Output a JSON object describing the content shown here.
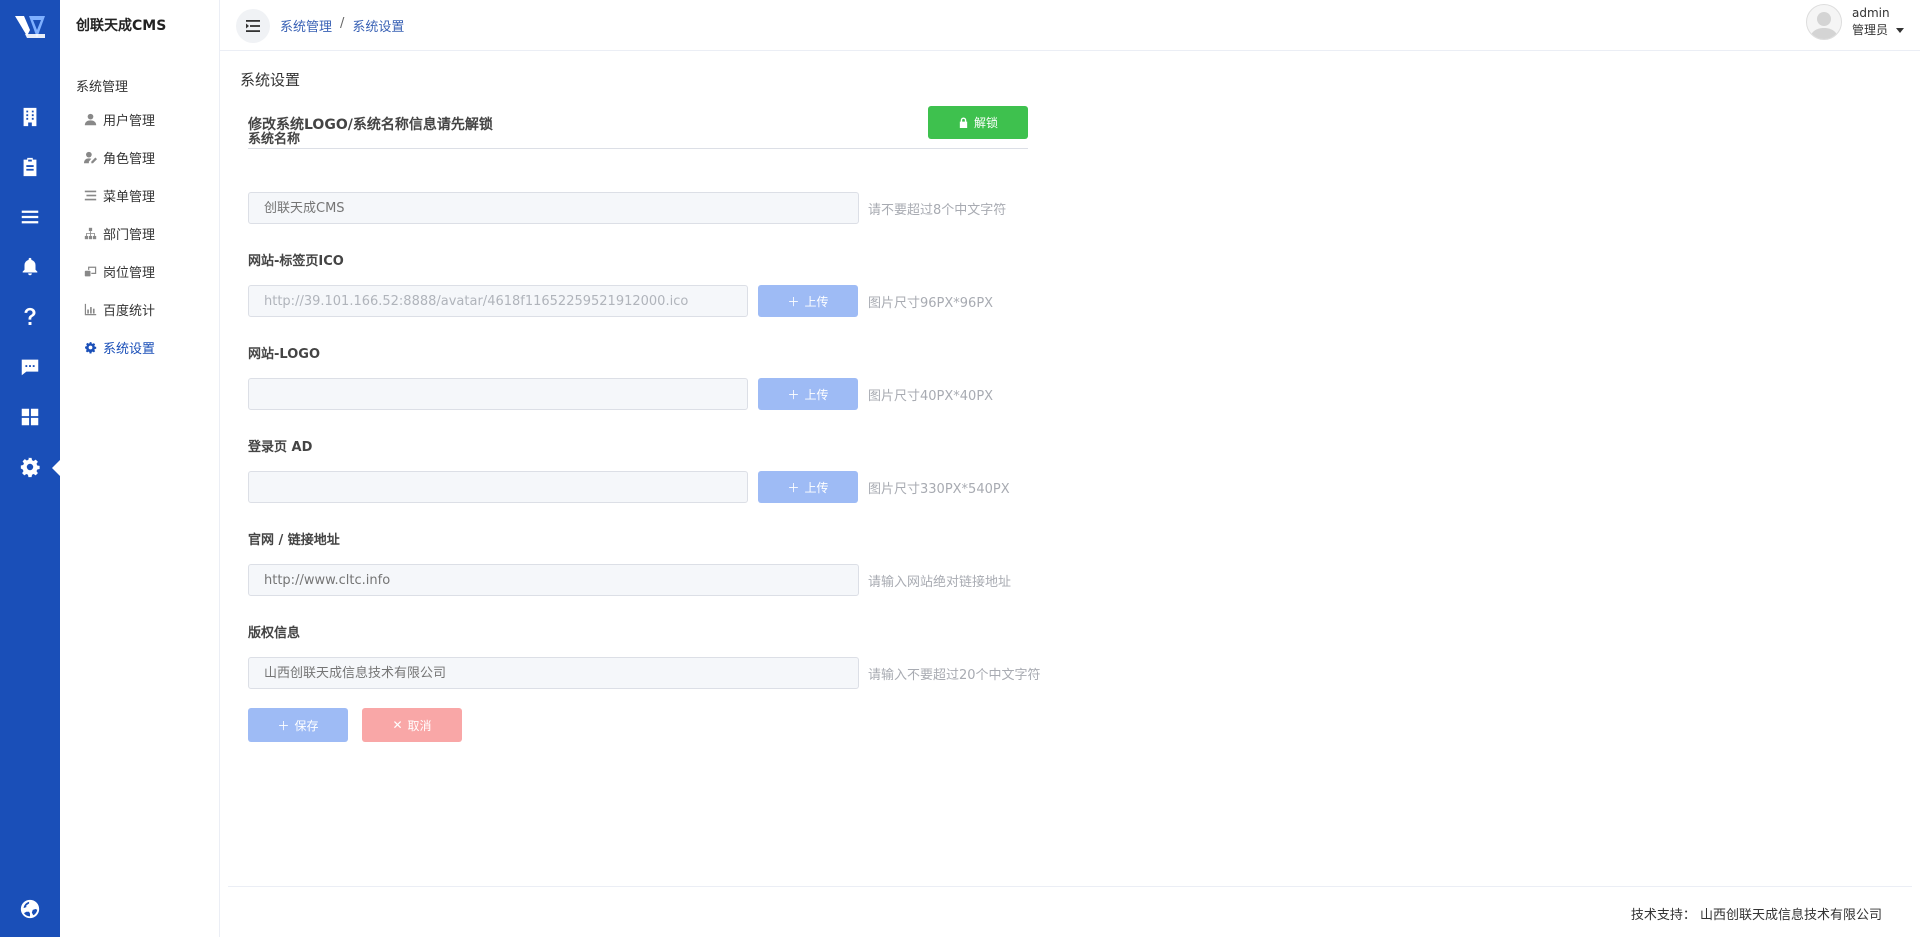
{
  "app": {
    "brand": "创联天成CMS"
  },
  "rail": {
    "icons": [
      "building-icon",
      "clipboard-icon",
      "list-icon",
      "bell-icon",
      "question-icon",
      "chat-icon",
      "grid-icon",
      "gear-icon",
      "globe-icon"
    ],
    "active": "gear-icon"
  },
  "sidebar": {
    "group_label": "系统管理",
    "items": [
      {
        "label": "用户管理",
        "icon": "user-icon"
      },
      {
        "label": "角色管理",
        "icon": "user-edit-icon"
      },
      {
        "label": "菜单管理",
        "icon": "menu-icon"
      },
      {
        "label": "部门管理",
        "icon": "org-tree-icon"
      },
      {
        "label": "岗位管理",
        "icon": "post-icon"
      },
      {
        "label": "百度统计",
        "icon": "chart-icon"
      },
      {
        "label": "系统设置",
        "icon": "gear-icon",
        "active": true
      }
    ]
  },
  "header": {
    "breadcrumb": [
      "系统管理",
      "系统设置"
    ],
    "breadcrumb_sep": "/",
    "user": {
      "name": "admin",
      "role": "管理员"
    }
  },
  "main": {
    "page_title": "系统设置",
    "unlock_text": "修改系统LOGO/系统名称信息请先解锁",
    "unlock_button": "解锁",
    "fields": {
      "system_name": {
        "label": "系统名称",
        "placeholder": "创联天成CMS",
        "hint": "请不要超过8个中文字符"
      },
      "favicon": {
        "label": "网站-标签页ICO",
        "value": "http://39.101.166.52:8888/avatar/4618f11652259521912000.ico",
        "button": "上传",
        "hint": "图片尺寸96PX*96PX"
      },
      "logo": {
        "label": "网站-LOGO",
        "value": "",
        "button": "上传",
        "hint": "图片尺寸40PX*40PX"
      },
      "login_ad": {
        "label": "登录页 AD",
        "value": "",
        "button": "上传",
        "hint": "图片尺寸330PX*540PX"
      },
      "website": {
        "label": "官网 / 链接地址",
        "placeholder": "http://www.cltc.info",
        "hint": "请输入网站绝对链接地址"
      },
      "copyright": {
        "label": "版权信息",
        "placeholder": "山西创联天成信息技术有限公司",
        "hint": "请输入不要超过20个中文字符"
      }
    },
    "save_button": "保存",
    "cancel_button": "取消"
  },
  "footer": {
    "text": "技术支持：  山西创联天成信息技术有限公司"
  },
  "colors": {
    "primary": "#1a4fb8",
    "success": "#3ec14e",
    "upload": "#9ebbf5",
    "danger_light": "#f9a7a7"
  }
}
